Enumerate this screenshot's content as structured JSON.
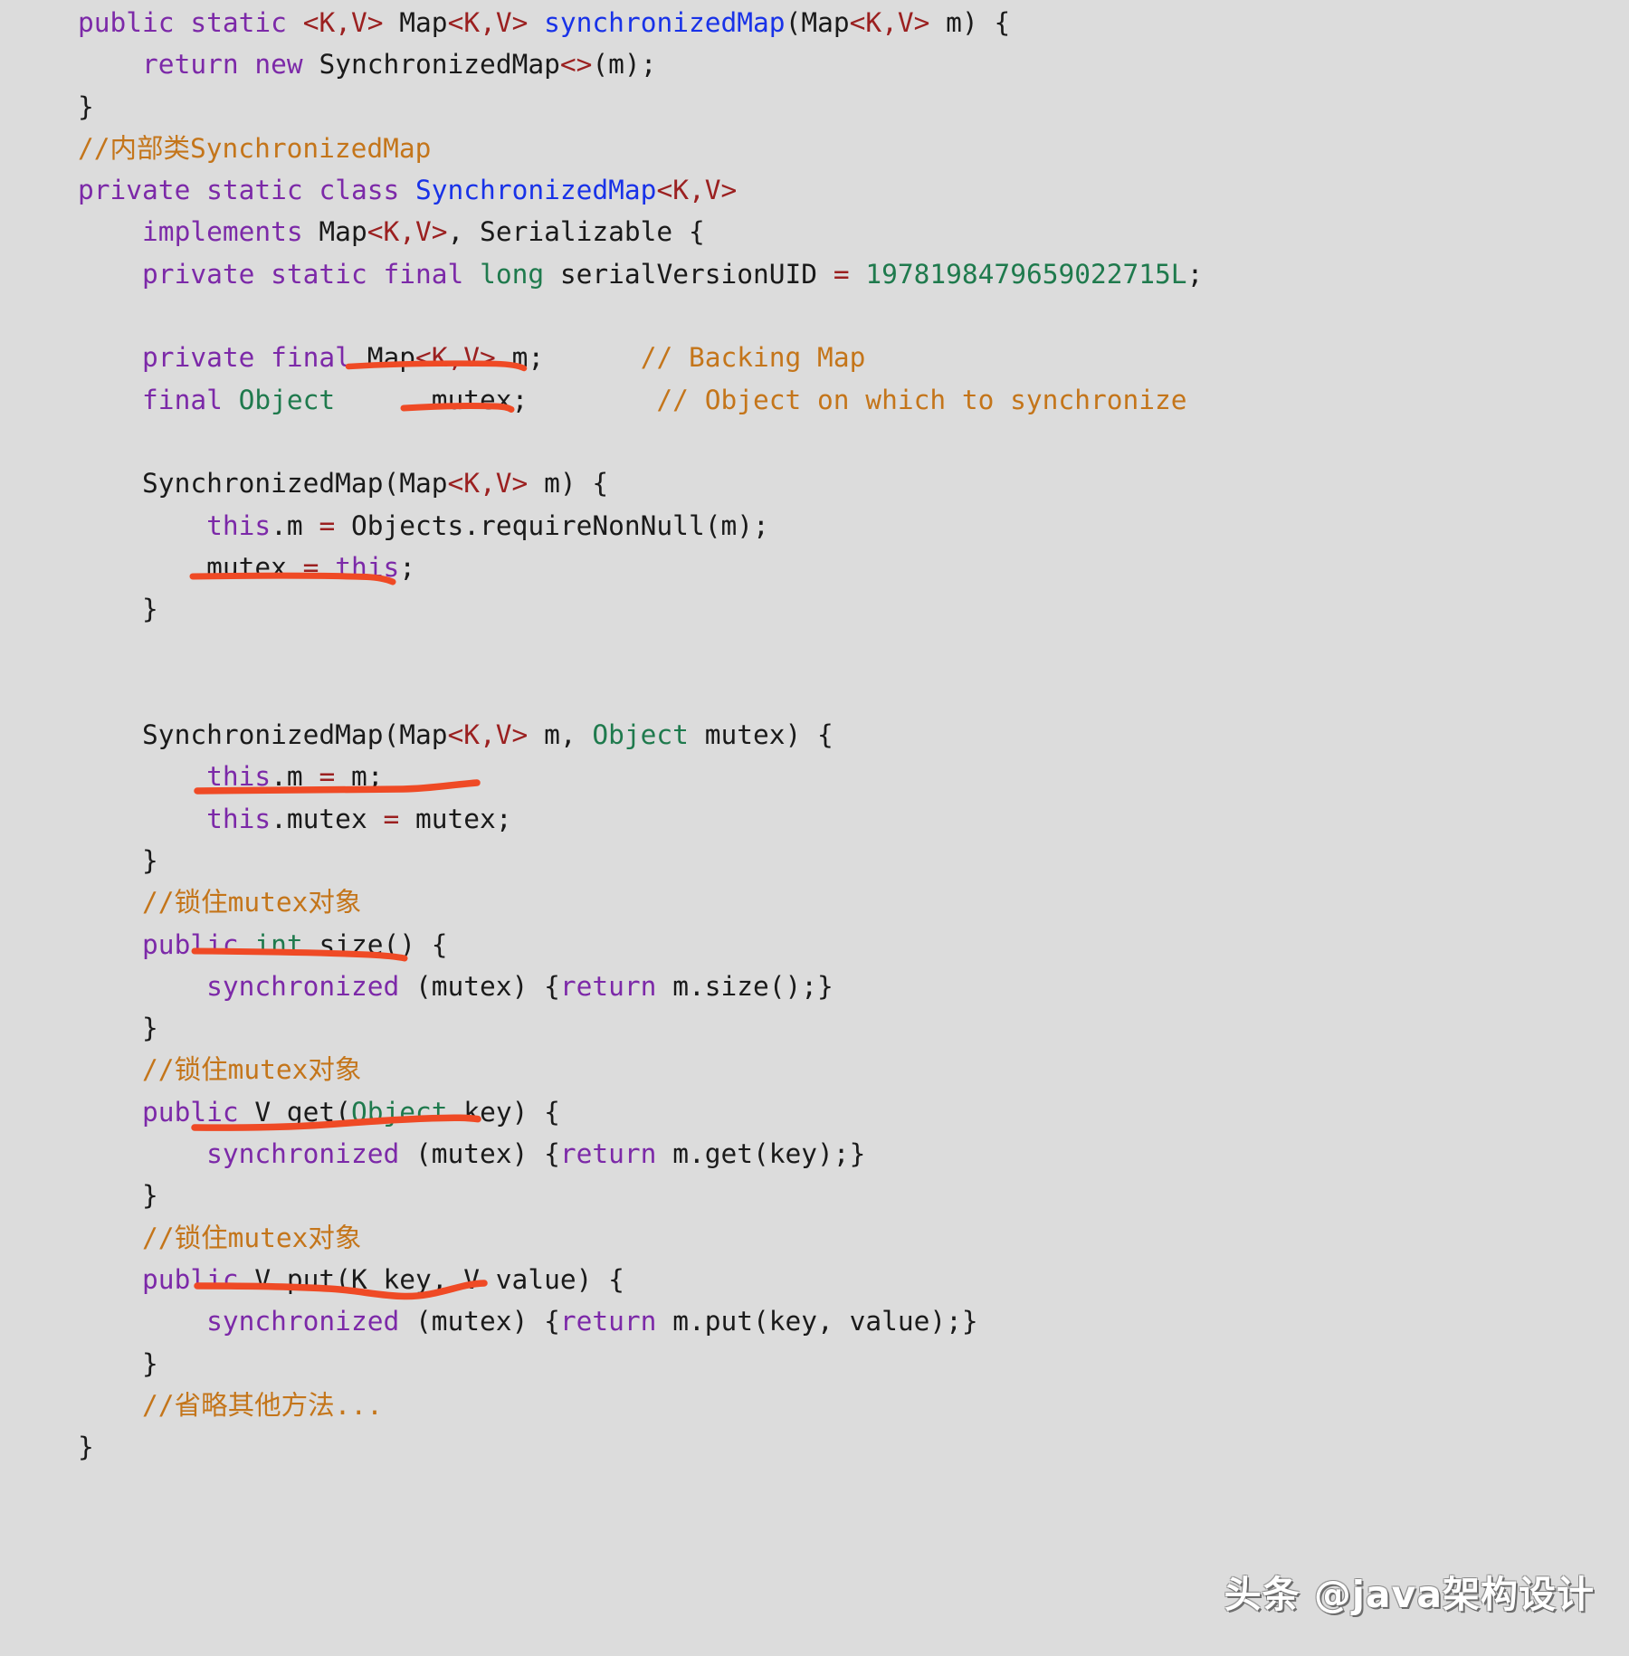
{
  "page": {
    "background_color": "#dcdcdc",
    "language": "java",
    "watermark": "头条 @java架构设计"
  },
  "theme": {
    "keyword_color": "#7c29a8",
    "type_color": "#1f7a4d",
    "class_color": "#1832e8",
    "generic_color": "#9b2020",
    "comment_color": "#c4751a",
    "number_color": "#1f7a4d",
    "plain_color": "#1a1a1a",
    "underline_color": "#ef4a25"
  },
  "code": {
    "lines": [
      {
        "id": "l1",
        "text": "public static <K,V> Map<K,V> synchronizedMap(Map<K,V> m) {"
      },
      {
        "id": "l2",
        "text": "    return new SynchronizedMap<>(m);"
      },
      {
        "id": "l3",
        "text": "}"
      },
      {
        "id": "l4",
        "text": "//内部类SynchronizedMap"
      },
      {
        "id": "l5",
        "text": "private static class SynchronizedMap<K,V>"
      },
      {
        "id": "l6",
        "text": "    implements Map<K,V>, Serializable {"
      },
      {
        "id": "l7",
        "text": "    private static final long serialVersionUID = 1978198479659022715L;"
      },
      {
        "id": "l8",
        "text": ""
      },
      {
        "id": "l9",
        "text": "    private final Map<K,V> m;      // Backing Map"
      },
      {
        "id": "l10",
        "text": "    final Object      mutex;        // Object on which to synchronize"
      },
      {
        "id": "l11",
        "text": ""
      },
      {
        "id": "l12",
        "text": "    SynchronizedMap(Map<K,V> m) {"
      },
      {
        "id": "l13",
        "text": "        this.m = Objects.requireNonNull(m);"
      },
      {
        "id": "l14",
        "text": "        mutex = this;"
      },
      {
        "id": "l15",
        "text": "    }"
      },
      {
        "id": "l16",
        "text": ""
      },
      {
        "id": "l17",
        "text": ""
      },
      {
        "id": "l18",
        "text": "    SynchronizedMap(Map<K,V> m, Object mutex) {"
      },
      {
        "id": "l19",
        "text": "        this.m = m;"
      },
      {
        "id": "l20",
        "text": "        this.mutex = mutex;"
      },
      {
        "id": "l21",
        "text": "    }"
      },
      {
        "id": "l22",
        "text": "    //锁住mutex对象"
      },
      {
        "id": "l23",
        "text": "    public int size() {"
      },
      {
        "id": "l24",
        "text": "        synchronized (mutex) {return m.size();}"
      },
      {
        "id": "l25",
        "text": "    }"
      },
      {
        "id": "l26",
        "text": "    //锁住mutex对象"
      },
      {
        "id": "l27",
        "text": "    public V get(Object key) {"
      },
      {
        "id": "l28",
        "text": "        synchronized (mutex) {return m.get(key);}"
      },
      {
        "id": "l29",
        "text": "    }"
      },
      {
        "id": "l30",
        "text": "    //锁住mutex对象"
      },
      {
        "id": "l31",
        "text": "    public V put(K key, V value) {"
      },
      {
        "id": "l32",
        "text": "        synchronized (mutex) {return m.put(key, value);}"
      },
      {
        "id": "l33",
        "text": "    }"
      },
      {
        "id": "l34",
        "text": "    //省略其他方法..."
      },
      {
        "id": "l35",
        "text": "}"
      }
    ],
    "annotations": [
      {
        "id": "a1",
        "target": "Map<K,V> m;",
        "line": "l9"
      },
      {
        "id": "a2",
        "target": "mutex;",
        "line": "l10"
      },
      {
        "id": "a3",
        "target": "mutex = this;",
        "line": "l14"
      },
      {
        "id": "a4",
        "target": "this.mutex = mutex;",
        "line": "l20"
      },
      {
        "id": "a5",
        "target": "synchronized",
        "line": "l24"
      },
      {
        "id": "a6",
        "target": "synchronized (mutex)",
        "line": "l28"
      },
      {
        "id": "a7",
        "target": "synchronized (mutex)",
        "line": "l32"
      }
    ]
  }
}
